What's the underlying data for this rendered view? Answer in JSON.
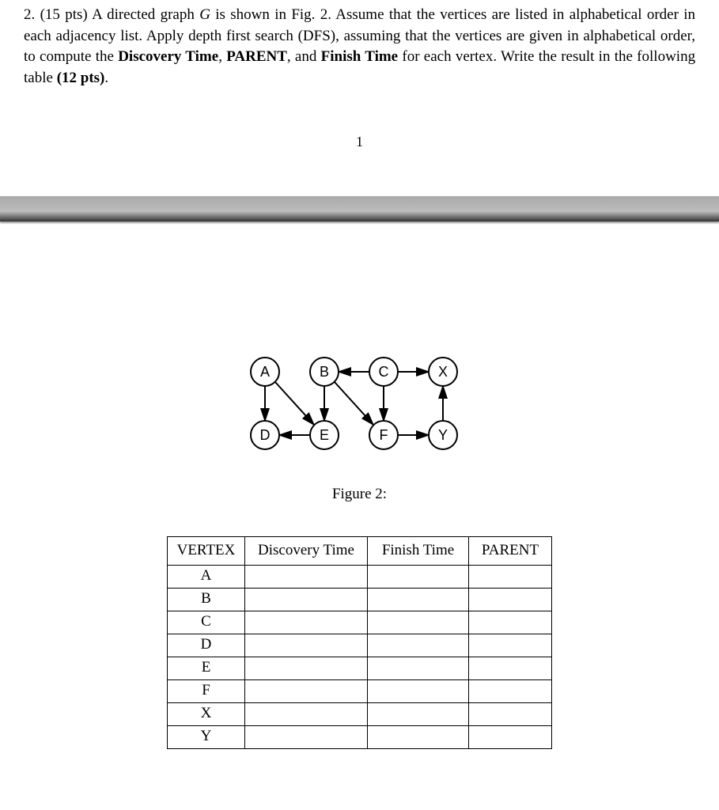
{
  "question": {
    "number": "2.",
    "points": "(15 pts)",
    "text_line": "A directed graph",
    "graph_var": "G",
    "text_line2": "is shown in Fig. 2. Assume that the vertices are listed in alphabetical order in each adjacency list. Apply depth first search (DFS), assuming that the vertices are given in alphabetical order, to compute the",
    "kw_discovery": "Discovery Time",
    "kw_parent": "PARENT",
    "kw_and": ", and",
    "kw_finish": "Finish Time",
    "text_line3": "for each vertex. Write the result in the following table",
    "table_pts": "(12 pts)",
    "period": "."
  },
  "page_number": "1",
  "graph": {
    "nodes": [
      "A",
      "B",
      "C",
      "X",
      "D",
      "E",
      "F",
      "Y"
    ],
    "caption": "Figure 2:"
  },
  "table": {
    "headers": {
      "vertex": "VERTEX",
      "disc": "Discovery Time",
      "fin": "Finish Time",
      "parent": "PARENT"
    },
    "rows": [
      "A",
      "B",
      "C",
      "D",
      "E",
      "F",
      "X",
      "Y"
    ]
  }
}
